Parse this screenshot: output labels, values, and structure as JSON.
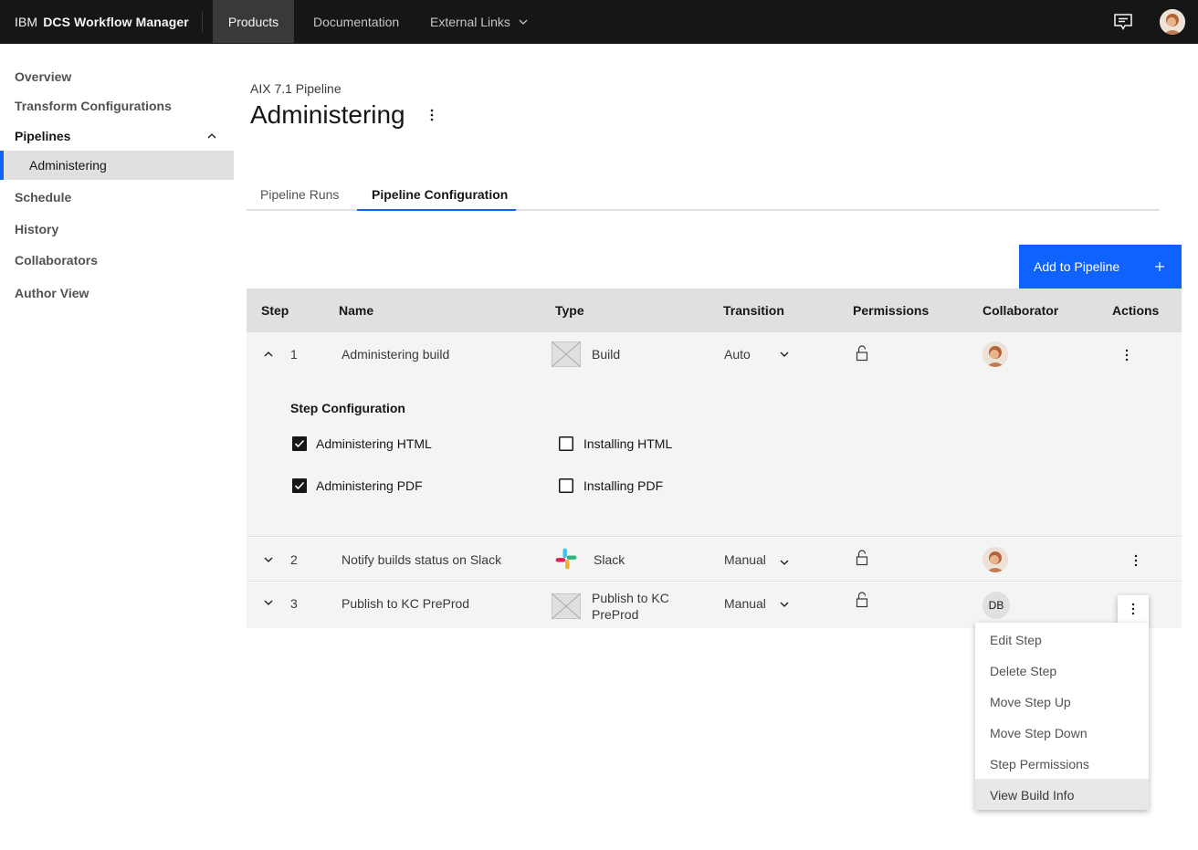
{
  "header": {
    "brand_prefix": "IBM",
    "brand_name": "DCS Workflow Manager",
    "nav": [
      {
        "label": "Products"
      },
      {
        "label": "Documentation"
      },
      {
        "label": "External Links"
      }
    ]
  },
  "sidebar": {
    "items": [
      {
        "label": "Overview"
      },
      {
        "label": "Transform Configurations"
      },
      {
        "label": "Pipelines"
      },
      {
        "label": "Administering"
      },
      {
        "label": "Schedule"
      },
      {
        "label": "History"
      },
      {
        "label": "Collaborators"
      },
      {
        "label": "Author View"
      }
    ]
  },
  "page": {
    "breadcrumb": "AIX 7.1 Pipeline",
    "title": "Administering"
  },
  "tabs": [
    {
      "label": "Pipeline Runs"
    },
    {
      "label": "Pipeline Configuration"
    }
  ],
  "add_button": "Add to Pipeline",
  "table": {
    "headers": [
      "Step",
      "Name",
      "Type",
      "Transition",
      "Permissions",
      "Collaborator",
      "Actions"
    ],
    "rows": [
      {
        "step": "1",
        "name": "Administering build",
        "type": "Build",
        "transition": "Auto"
      },
      {
        "step": "2",
        "name": "Notify builds status on Slack",
        "type": "Slack",
        "transition": "Manual"
      },
      {
        "step": "3",
        "name": "Publish to KC PreProd",
        "type_line1": "Publish to KC",
        "type_line2": "PreProd",
        "transition": "Manual",
        "collaborator_initials": "DB"
      }
    ]
  },
  "step_config": {
    "title": "Step Configuration",
    "options": [
      {
        "label": "Administering HTML",
        "checked": true
      },
      {
        "label": "Installing HTML",
        "checked": false
      },
      {
        "label": "Administering PDF",
        "checked": true
      },
      {
        "label": "Installing PDF",
        "checked": false
      }
    ]
  },
  "overflow_menu": {
    "items": [
      {
        "label": "Edit Step"
      },
      {
        "label": "Delete Step"
      },
      {
        "label": "Move Step Up"
      },
      {
        "label": "Move Step Down"
      },
      {
        "label": "Step Permissions"
      },
      {
        "label": "View Build Info"
      }
    ]
  },
  "colors": {
    "header_bg": "#161616",
    "accent": "#0f62fe",
    "table_header": "#e0e0e0",
    "row_bg": "#f4f4f4"
  }
}
